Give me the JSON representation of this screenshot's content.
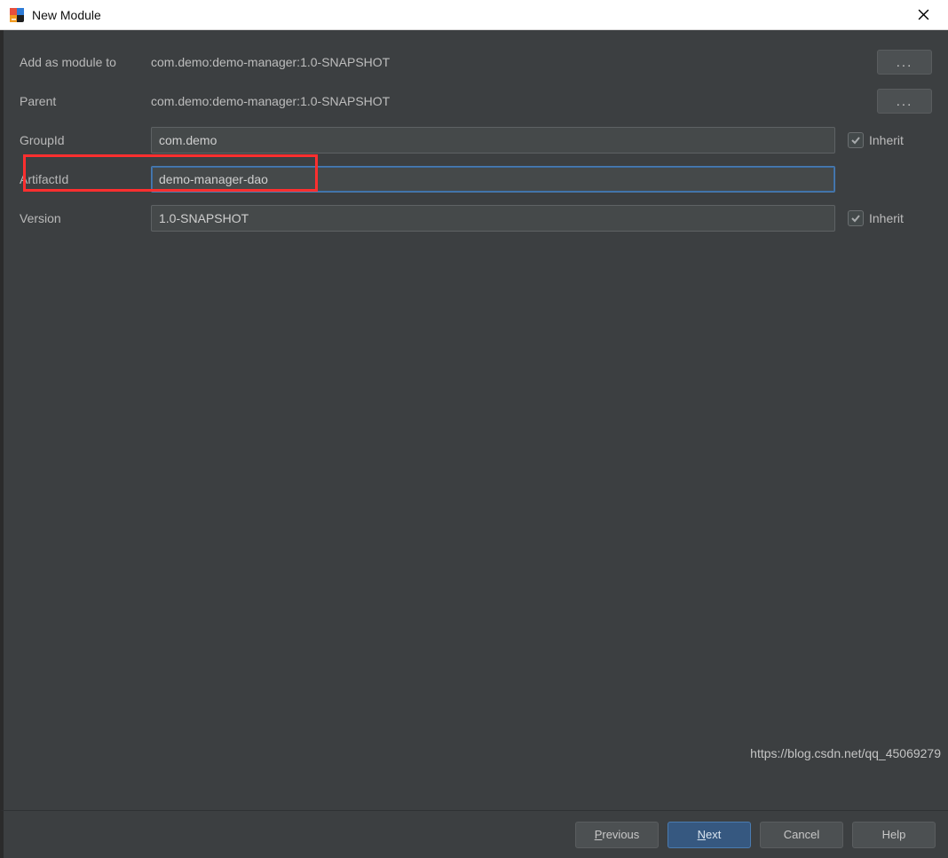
{
  "titlebar": {
    "title": "New Module"
  },
  "form": {
    "add_as_module_label": "Add as module to",
    "add_as_module_value": "com.demo:demo-manager:1.0-SNAPSHOT",
    "parent_label": "Parent",
    "parent_value": "com.demo:demo-manager:1.0-SNAPSHOT",
    "groupid_label": "GroupId",
    "groupid_value": "com.demo",
    "artifactid_label": "ArtifactId",
    "artifactid_value": "demo-manager-dao",
    "version_label": "Version",
    "version_value": "1.0-SNAPSHOT",
    "inherit_label": "Inherit",
    "ellipsis": "..."
  },
  "footer": {
    "previous": "Previous",
    "next": "Next",
    "cancel": "Cancel",
    "help": "Help"
  },
  "watermark": "https://blog.csdn.net/qq_45069279"
}
